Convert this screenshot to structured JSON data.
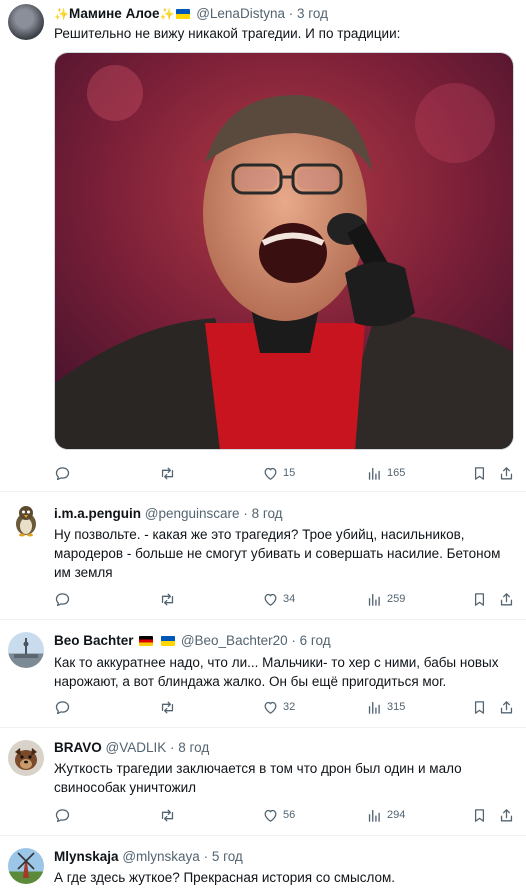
{
  "tweets": [
    {
      "name": "Мамине Алое",
      "handle": "@LenaDistyna",
      "time": "3 год",
      "text": "Решительно не вижу никакой  трагедии. И по традиции:",
      "likes": "15",
      "views": "165"
    },
    {
      "name": "i.m.a.penguin",
      "handle": "@penguinscare",
      "time": "8 год",
      "text": "Ну позвольте. - какая же это трагедия? Трое убийц, насильников, мародеров - больше не смогут убивать и совершать насилие. Бетоном им земля",
      "likes": "34",
      "views": "259"
    },
    {
      "name": "Beo Bachter",
      "handle": "@Beo_Bachter20",
      "time": "6 год",
      "text": "Как то аккуратнее надо, что ли... Мальчики- то хер с ними, бабы новых нарожают, а вот блиндажа жалко. Он бы ещё пригодиться мог.",
      "likes": "32",
      "views": "315"
    },
    {
      "name": "BRAVO",
      "handle": "@VADLIK",
      "time": "8 год",
      "text": "Жуткость трагедии заключается в том что дрон был один и мало свинособак уничтожил",
      "likes": "56",
      "views": "294"
    },
    {
      "name": "Mlynskaja",
      "handle": "@mlynskaya",
      "time": "5 год",
      "text": "А где здесь жуткое? Прекрасная история со смыслом."
    }
  ],
  "separator": "·",
  "colors": {
    "text": "#0f1419",
    "secondary": "#536471",
    "border": "#eff3f4"
  }
}
